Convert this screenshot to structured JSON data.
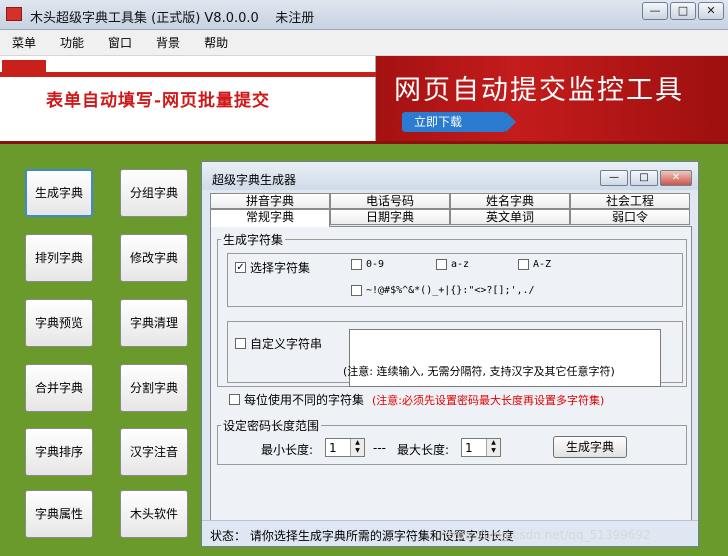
{
  "window": {
    "title": "木头超级字典工具集 (正式版) V8.0.0.0    未注册",
    "app_icon": "app-icon",
    "min_label": "—",
    "max_label": "□",
    "close_label": "✕"
  },
  "menu": [
    "菜单",
    "功能",
    "窗口",
    "背景",
    "帮助"
  ],
  "banner": {
    "left_text": "表单自动填写-网页批量提交",
    "right_text": "网页自动提交监控工具",
    "cta": "立即下载"
  },
  "side_buttons": {
    "left": [
      "生成字典",
      "排列字典",
      "字典预览",
      "合并字典",
      "字典排序",
      "字典属性"
    ],
    "right": [
      "分组字典",
      "修改字典",
      "字典清理",
      "分割字典",
      "汉字注音",
      "木头软件"
    ]
  },
  "subwindow": {
    "title": "超级字典生成器",
    "tabs_row1": [
      "拼音字典",
      "电话号码",
      "姓名字典",
      "社会工程"
    ],
    "tabs_row2": [
      "常规字典",
      "日期字典",
      "英文单词",
      "弱口令"
    ],
    "charset_group": "生成字符集",
    "select_charset": "选择字符集",
    "options": [
      "0-9",
      "a-z",
      "A-Z"
    ],
    "symbols": "~!@#$%^&*()_+|{}:\"<>?[];',./",
    "custom_charset": "自定义字符串",
    "custom_note": "(注意: 连续输入, 无需分隔符, 支持汉字及其它任意字符)",
    "per_position": "每位使用不同的字符集",
    "per_position_note": "(注意:必须先设置密码最大长度再设置多字符集)",
    "length_group": "设定密码长度范围",
    "min_label": "最小长度:",
    "min_value": "1",
    "separator": "---",
    "max_label": "最大长度:",
    "max_value": "1",
    "generate": "生成字典",
    "status": "状态： 请你选择生成字典所需的源字符集和设置字典长度"
  },
  "watermark": "https://blog.csdn.net/qq_51399692"
}
